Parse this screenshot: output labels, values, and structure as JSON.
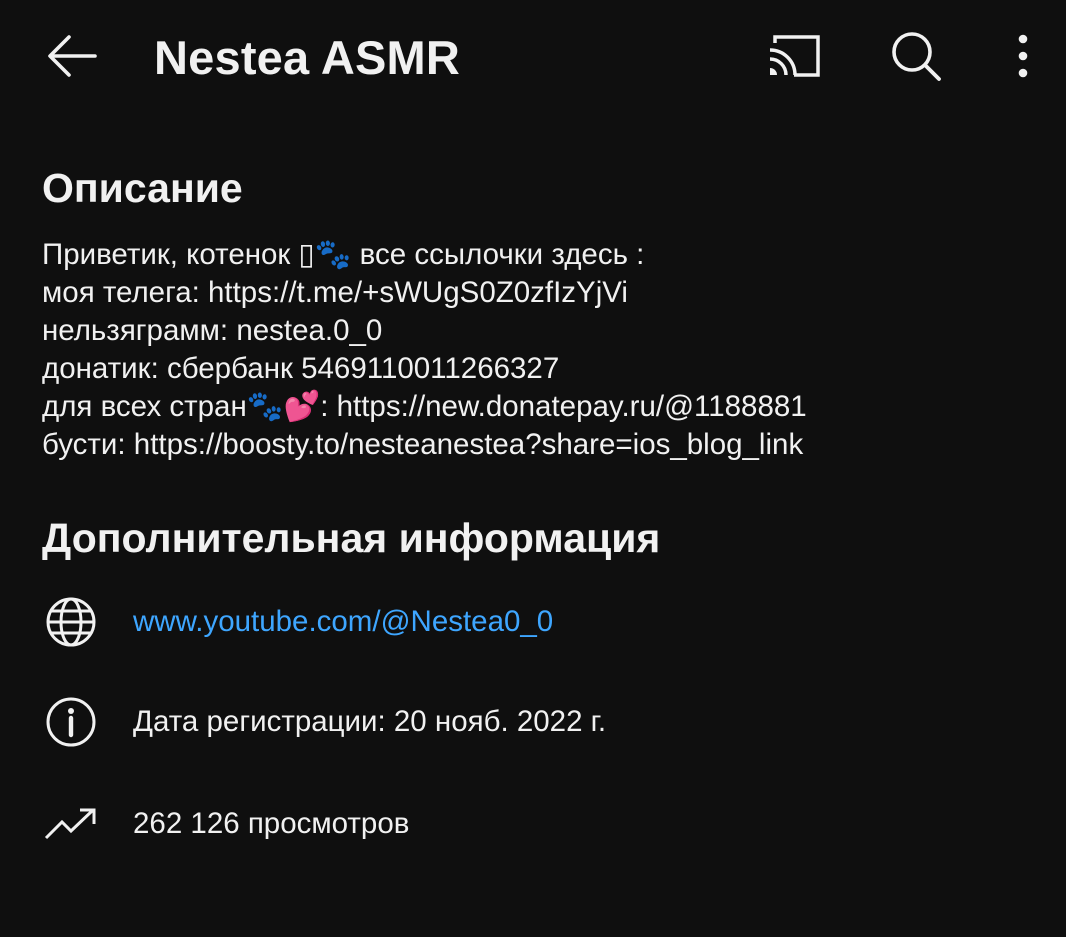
{
  "appbar": {
    "title": "Nestea ASMR",
    "back_icon": "arrow-back-icon",
    "cast_icon": "cast-icon",
    "search_icon": "search-icon",
    "more_icon": "more-vert-icon"
  },
  "description": {
    "heading": "Описание",
    "lines": [
      "Приветик, котенок ▯🐾 все ссылочки здесь :",
      "моя телега:  https://t.me/+sWUgS0Z0zfIzYjVi",
      "нельзяграмм: nestea.0_0",
      "донатик: сбербанк 5469110011266327",
      "для всех стран🐾💕: https://new.donatepay.ru/@1188881",
      "бусти: https://boosty.to/nesteanestea?share=ios_blog_link"
    ]
  },
  "additional_info": {
    "heading": "Дополнительная информация",
    "website": "www.youtube.com/@Nestea0_0",
    "registered": "Дата регистрации: 20 нояб. 2022 г.",
    "views": "262 126 просмотров",
    "icons": [
      "globe-icon",
      "info-icon",
      "trending-icon"
    ]
  },
  "colors": {
    "background": "#0f0f0f",
    "text": "#f1f1f1",
    "link": "#3ea6ff"
  }
}
